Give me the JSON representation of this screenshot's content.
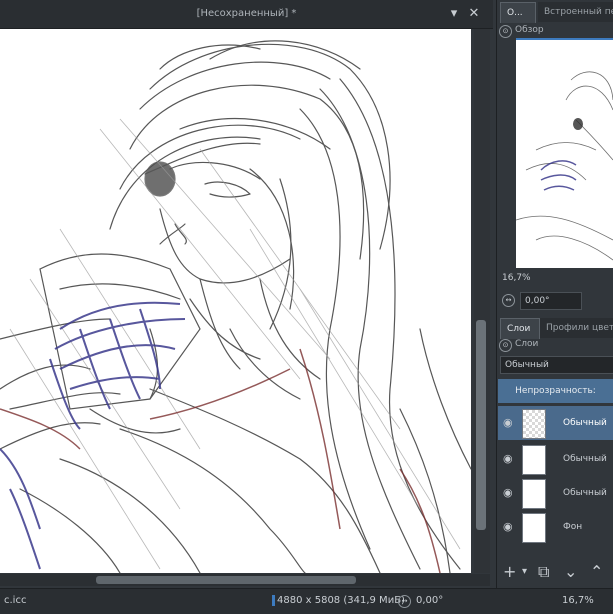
{
  "document": {
    "title": "[Несохраненный] *",
    "minimize_glyph": "▾",
    "close_glyph": "✕"
  },
  "statusbar": {
    "profile": "c.icc",
    "image_size": "4880 x 5808 (341,9 МиБ)",
    "rotation": "0,00°",
    "zoom": "16,7%"
  },
  "panel": {
    "top_tabs": [
      "О...",
      "Встроенный пер"
    ],
    "overview_title": "Обзор",
    "overview_zoom": "16,7%",
    "overview_rotation": "0,00°",
    "layer_tabs": [
      "Слои",
      "Профили цвет"
    ],
    "layers_title": "Слои",
    "blend_mode": "Обычный",
    "opacity_label": "Непрозрачность:",
    "layers": [
      {
        "name": "Обычный",
        "selected": true
      },
      {
        "name": "Обычный",
        "selected": false
      },
      {
        "name": "Обычный",
        "selected": false
      },
      {
        "name": "Фон",
        "selected": false
      }
    ],
    "bottom_tools": [
      "+",
      "▾",
      "⧉",
      "⌄",
      "⌃"
    ]
  },
  "colors": {
    "accent": "#4a6f94",
    "selected_layer": "#4a6a8c",
    "panel_bg": "#31363b",
    "sketch_dark": "#3a3a3a",
    "sketch_blue": "#3b3a8c",
    "sketch_red": "#7a3030"
  },
  "icons": [
    "eye-icon",
    "rotate-icon",
    "dock-icon"
  ]
}
